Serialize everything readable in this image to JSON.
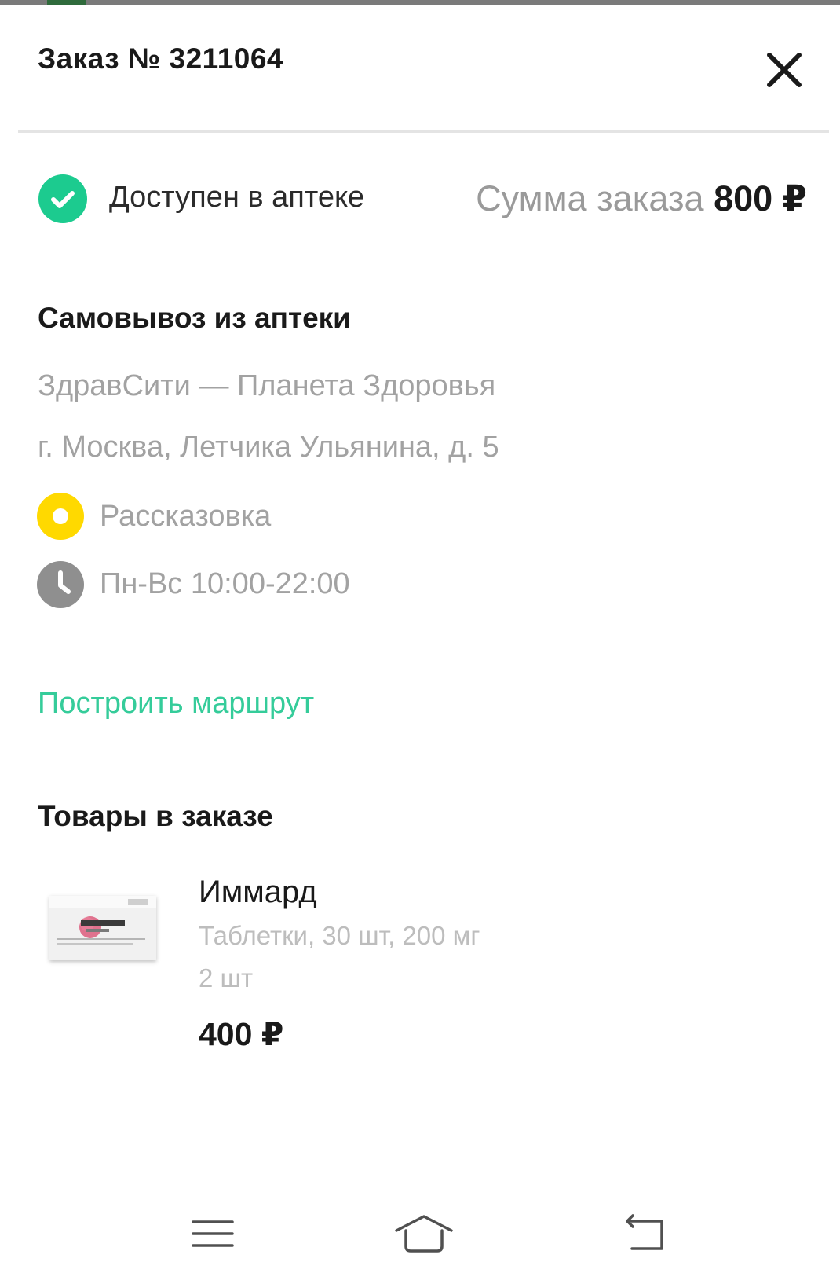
{
  "order": {
    "title": "Заказ № 3211064"
  },
  "status": {
    "text": "Доступен в аптеке",
    "sum_label": "Сумма заказа",
    "sum_value": "800 ₽"
  },
  "pickup": {
    "heading": "Самовывоз из аптеки",
    "pharmacy_name": "ЗдравСити — Планета Здоровья",
    "address": "г. Москва, Летчика Ульянина, д. 5",
    "metro": "Рассказовка",
    "hours": "Пн-Вс 10:00-22:00",
    "route_link": "Построить маршрут"
  },
  "items_section": {
    "heading": "Товары в заказе",
    "items": [
      {
        "name": "Иммард",
        "description": "Таблетки, 30 шт, 200 мг",
        "quantity": "2 шт",
        "price": "400 ₽"
      }
    ]
  },
  "colors": {
    "accent_green": "#35cc9a",
    "status_green": "#1ccb8f",
    "metro_yellow": "#ffd900"
  },
  "icons": {
    "close": "close-icon",
    "status": "check-circle-icon",
    "metro": "metro-station-icon",
    "hours": "clock-icon",
    "nav_menu": "menu-icon",
    "nav_home": "home-icon",
    "nav_back": "back-icon"
  }
}
